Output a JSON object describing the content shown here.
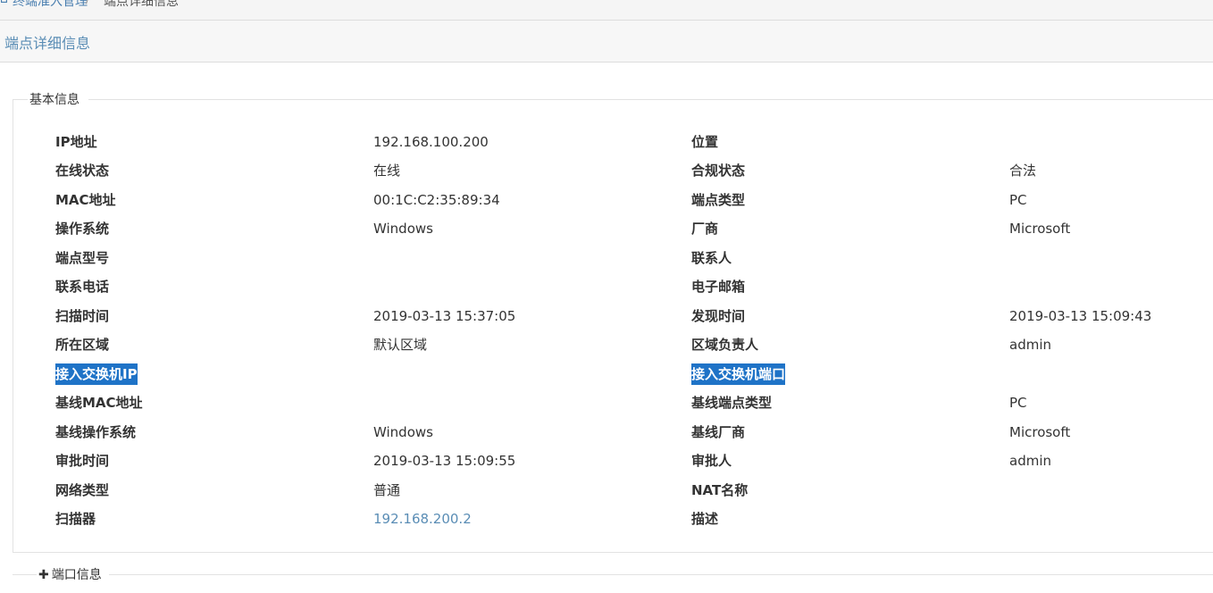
{
  "breadcrumb": {
    "home": "终端准入管理",
    "separator": "/",
    "current": "端点详细信息"
  },
  "page_title": "端点详细信息",
  "basic_info": {
    "legend": "基本信息",
    "left": [
      {
        "label": "IP地址",
        "value": ""
      },
      {
        "label": "在线状态",
        "value": "在线"
      },
      {
        "label": "MAC地址",
        "value": "00:1C:C2:35:89:34"
      },
      {
        "label": "操作系统",
        "value": "Windows"
      },
      {
        "label": "端点型号",
        "value": ""
      },
      {
        "label": "联系电话",
        "value": ""
      },
      {
        "label": "扫描时间",
        "value": "2019-03-13 15:37:05"
      },
      {
        "label": "所在区域",
        "value": "默认区域"
      },
      {
        "label": "接入交换机IP",
        "value": ""
      },
      {
        "label": "基线MAC地址",
        "value": ""
      },
      {
        "label": "基线操作系统",
        "value": "Windows"
      },
      {
        "label": "审批时间",
        "value": "2019-03-13 15:09:55"
      },
      {
        "label": "网络类型",
        "value": "普通"
      },
      {
        "label": "扫描器",
        "value": "192.168.200.2"
      }
    ],
    "ip_value": "192.168.100.200",
    "right": [
      {
        "label": "位置",
        "value": ""
      },
      {
        "label": "合规状态",
        "value": "合法"
      },
      {
        "label": "端点类型",
        "value": "PC"
      },
      {
        "label": "厂商",
        "value": "Microsoft"
      },
      {
        "label": "联系人",
        "value": ""
      },
      {
        "label": "电子邮箱",
        "value": ""
      },
      {
        "label": "发现时间",
        "value": "2019-03-13 15:09:43"
      },
      {
        "label": "区域负责人",
        "value": "admin"
      },
      {
        "label": "接入交换机端口",
        "value": ""
      },
      {
        "label": "基线端点类型",
        "value": "PC"
      },
      {
        "label": "基线厂商",
        "value": "Microsoft"
      },
      {
        "label": "审批人",
        "value": "admin"
      },
      {
        "label": "NAT名称",
        "value": ""
      },
      {
        "label": "描述",
        "value": ""
      }
    ]
  },
  "port_info": {
    "icon": "plus-icon",
    "legend": "端口信息"
  },
  "colors": {
    "link": "#5a8db5",
    "highlight": "#1f73c7"
  }
}
